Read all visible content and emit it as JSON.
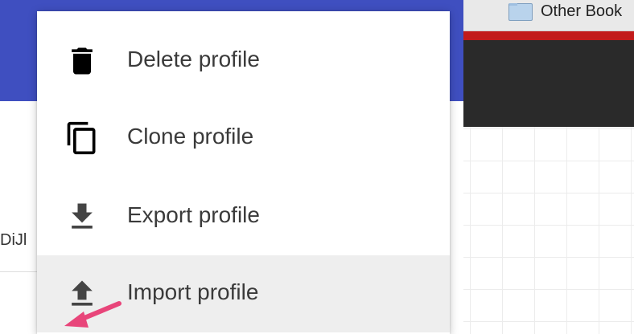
{
  "background": {
    "left_cut_text": "DiJl",
    "bookmarks_bar": {
      "folder_label": "Other Book"
    }
  },
  "menu": {
    "items": [
      {
        "label": "Delete profile",
        "icon": "trash-icon"
      },
      {
        "label": "Clone profile",
        "icon": "copy-icon"
      },
      {
        "label": "Export profile",
        "icon": "download-icon"
      },
      {
        "label": "Import profile",
        "icon": "upload-icon",
        "highlighted": true
      }
    ]
  },
  "colors": {
    "header": "#3f4fc0",
    "highlight": "#eeeeee",
    "accent_strip": "#c21a1a",
    "annotation_arrow": "#e8457a"
  }
}
